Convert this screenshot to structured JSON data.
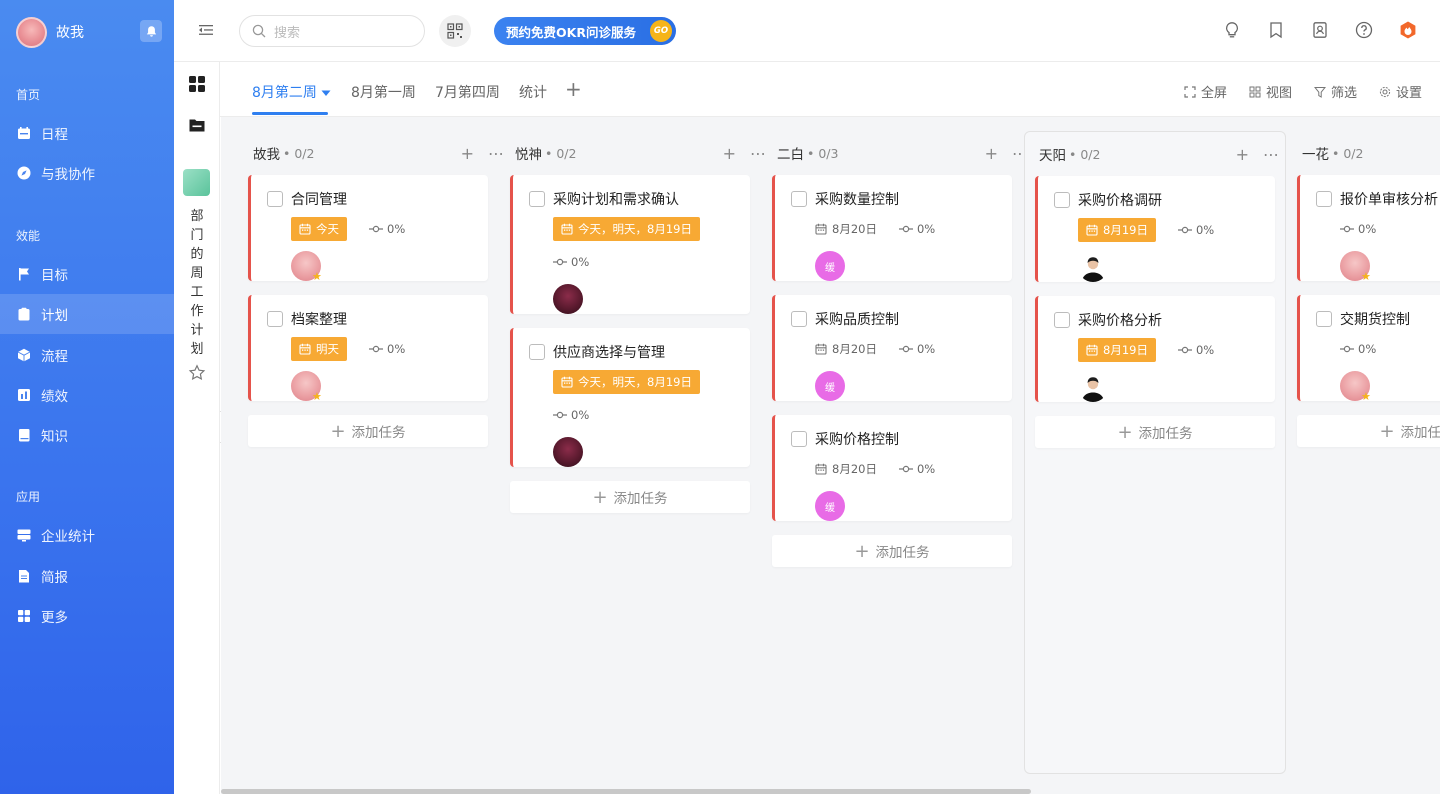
{
  "user": {
    "name": "故我"
  },
  "sidebar": {
    "groups": [
      "首页",
      "效能",
      "应用"
    ],
    "items": [
      {
        "label": "日程",
        "icon": "calendar-icon"
      },
      {
        "label": "与我协作",
        "icon": "compass-icon"
      },
      {
        "label": "目标",
        "icon": "flag-icon"
      },
      {
        "label": "计划",
        "icon": "clipboard-icon",
        "active": true
      },
      {
        "label": "流程",
        "icon": "cube-icon"
      },
      {
        "label": "绩效",
        "icon": "chart-icon"
      },
      {
        "label": "知识",
        "icon": "book-icon"
      },
      {
        "label": "企业统计",
        "icon": "monitor-icon"
      },
      {
        "label": "简报",
        "icon": "document-icon"
      },
      {
        "label": "更多",
        "icon": "grid-icon"
      }
    ]
  },
  "topbar": {
    "search_placeholder": "搜索",
    "promo_label": "预约免费OKR问诊服务",
    "promo_badge": "GO"
  },
  "subpanel": {
    "title": "部门的周工作计划"
  },
  "tabs": [
    {
      "label": "8月第二周",
      "active": true
    },
    {
      "label": "8月第一周"
    },
    {
      "label": "7月第四周"
    },
    {
      "label": "统计"
    }
  ],
  "tab_add": "+",
  "view_tools": [
    {
      "label": "全屏",
      "icon": "fullscreen-icon"
    },
    {
      "label": "视图",
      "icon": "view-icon"
    },
    {
      "label": "筛选",
      "icon": "filter-icon"
    },
    {
      "label": "设置",
      "icon": "settings-icon"
    }
  ],
  "board": {
    "add_task_label": "添加任务",
    "columns": [
      {
        "name": "故我",
        "count": "• 0/2",
        "tasks": [
          {
            "title": "合同管理",
            "date": "今天",
            "date_style": "tag",
            "progress": "0%",
            "avatar": "pink"
          },
          {
            "title": "档案整理",
            "date": "明天",
            "date_style": "tag",
            "progress": "0%",
            "avatar": "pink"
          }
        ]
      },
      {
        "name": "悦神",
        "count": "• 0/2",
        "tasks": [
          {
            "title": "采购计划和需求确认",
            "date": "今天，明天，8月19日",
            "date_style": "tag",
            "progress": "0%",
            "avatar": "dark"
          },
          {
            "title": "供应商选择与管理",
            "date": "今天，明天，8月19日",
            "date_style": "tag",
            "progress": "0%",
            "avatar": "dark"
          }
        ]
      },
      {
        "name": "二白",
        "count": "• 0/3",
        "tasks": [
          {
            "title": "采购数量控制",
            "date": "8月20日",
            "date_style": "plain",
            "progress": "0%",
            "avatar": "violet",
            "avatar_text": "缓"
          },
          {
            "title": "采购品质控制",
            "date": "8月20日",
            "date_style": "plain",
            "progress": "0%",
            "avatar": "violet",
            "avatar_text": "缓"
          },
          {
            "title": "采购价格控制",
            "date": "8月20日",
            "date_style": "plain",
            "progress": "0%",
            "avatar": "violet",
            "avatar_text": "缓"
          }
        ]
      },
      {
        "name": "天阳",
        "count": "• 0/2",
        "tasks": [
          {
            "title": "采购价格调研",
            "date": "8月19日",
            "date_style": "tag",
            "progress": "0%",
            "avatar": "man"
          },
          {
            "title": "采购价格分析",
            "date": "8月19日",
            "date_style": "tag",
            "progress": "0%",
            "avatar": "man"
          }
        ]
      },
      {
        "name": "一花",
        "count": "• 0/2",
        "tasks": [
          {
            "title": "报价单审核分析",
            "date": "",
            "date_style": "none",
            "progress": "0%",
            "avatar": "pink"
          },
          {
            "title": "交期货控制",
            "date": "",
            "date_style": "none",
            "progress": "0%",
            "avatar": "pink"
          }
        ]
      }
    ]
  },
  "colors": {
    "sidebar_top": "#4a8bf0",
    "accent": "#2f7ff0",
    "date_tag": "#f7a934",
    "card_border": "#e5534b",
    "badge": "#f6b419"
  }
}
